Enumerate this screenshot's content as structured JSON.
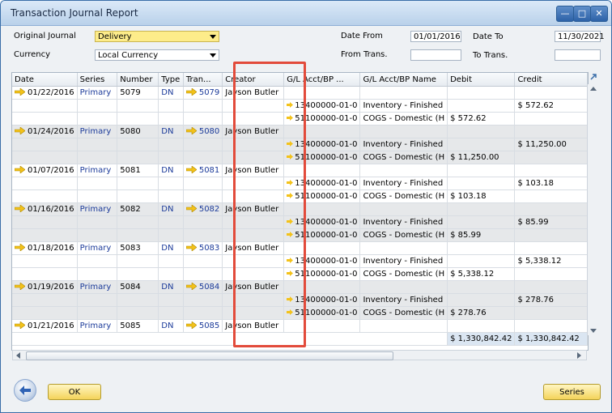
{
  "window": {
    "title": "Transaction Journal Report"
  },
  "filters": {
    "original_journal_label": "Original Journal",
    "original_journal_value": "Delivery",
    "currency_label": "Currency",
    "currency_value": "Local Currency",
    "date_from_label": "Date From",
    "date_from_value": "01/01/2016",
    "date_to_label": "Date To",
    "date_to_value": "11/30/2021",
    "from_trans_label": "From Trans.",
    "from_trans_value": "",
    "to_trans_label": "To Trans.",
    "to_trans_value": ""
  },
  "table": {
    "columns": [
      "Date",
      "Series",
      "Number",
      "Type",
      "Tran...",
      "Creator",
      "G/L Acct/BP ...",
      "G/L Acct/BP Name",
      "Debit",
      "Credit"
    ],
    "groups": [
      {
        "date": "01/22/2016",
        "series": "Primary",
        "number": "5079",
        "type": "DN",
        "trans": "5079",
        "creator": "Jayson Butler",
        "lines": [
          {
            "acct": "13400000-01-0",
            "name": "Inventory - Finished",
            "debit": "",
            "credit": "$ 572.62"
          },
          {
            "acct": "51100000-01-0",
            "name": "COGS - Domestic (H",
            "debit": "$ 572.62",
            "credit": ""
          }
        ]
      },
      {
        "date": "01/24/2016",
        "series": "Primary",
        "number": "5080",
        "type": "DN",
        "trans": "5080",
        "creator": "Jayson Butler",
        "lines": [
          {
            "acct": "13400000-01-0",
            "name": "Inventory - Finished",
            "debit": "",
            "credit": "$ 11,250.00"
          },
          {
            "acct": "51100000-01-0",
            "name": "COGS - Domestic (H",
            "debit": "$ 11,250.00",
            "credit": ""
          }
        ]
      },
      {
        "date": "01/07/2016",
        "series": "Primary",
        "number": "5081",
        "type": "DN",
        "trans": "5081",
        "creator": "Jayson Butler",
        "lines": [
          {
            "acct": "13400000-01-0",
            "name": "Inventory - Finished",
            "debit": "",
            "credit": "$ 103.18"
          },
          {
            "acct": "51100000-01-0",
            "name": "COGS - Domestic (H",
            "debit": "$ 103.18",
            "credit": ""
          }
        ]
      },
      {
        "date": "01/16/2016",
        "series": "Primary",
        "number": "5082",
        "type": "DN",
        "trans": "5082",
        "creator": "Jayson Butler",
        "lines": [
          {
            "acct": "13400000-01-0",
            "name": "Inventory - Finished",
            "debit": "",
            "credit": "$ 85.99"
          },
          {
            "acct": "51100000-01-0",
            "name": "COGS - Domestic (H",
            "debit": "$ 85.99",
            "credit": ""
          }
        ]
      },
      {
        "date": "01/18/2016",
        "series": "Primary",
        "number": "5083",
        "type": "DN",
        "trans": "5083",
        "creator": "Jayson Butler",
        "lines": [
          {
            "acct": "13400000-01-0",
            "name": "Inventory - Finished",
            "debit": "",
            "credit": "$ 5,338.12"
          },
          {
            "acct": "51100000-01-0",
            "name": "COGS - Domestic (H",
            "debit": "$ 5,338.12",
            "credit": ""
          }
        ]
      },
      {
        "date": "01/19/2016",
        "series": "Primary",
        "number": "5084",
        "type": "DN",
        "trans": "5084",
        "creator": "Jayson Butler",
        "lines": [
          {
            "acct": "13400000-01-0",
            "name": "Inventory - Finished",
            "debit": "",
            "credit": "$ 278.76"
          },
          {
            "acct": "51100000-01-0",
            "name": "COGS - Domestic (H",
            "debit": "$ 278.76",
            "credit": ""
          }
        ]
      },
      {
        "date": "01/21/2016",
        "series": "Primary",
        "number": "5085",
        "type": "DN",
        "trans": "5085",
        "creator": "Jayson Butler",
        "lines": []
      }
    ],
    "total_debit": "$ 1,330,842.42",
    "total_credit": "$ 1,330,842.42"
  },
  "buttons": {
    "ok_label": "OK",
    "series_label": "Series"
  },
  "colors": {
    "highlight": "#e24b3b",
    "link_blue": "#1c3b9a",
    "link_arrow": "#f3c21a"
  },
  "icons": {
    "link_arrow": "link-arrow-icon",
    "back": "back-arrow-icon",
    "expand": "expand-icon"
  }
}
